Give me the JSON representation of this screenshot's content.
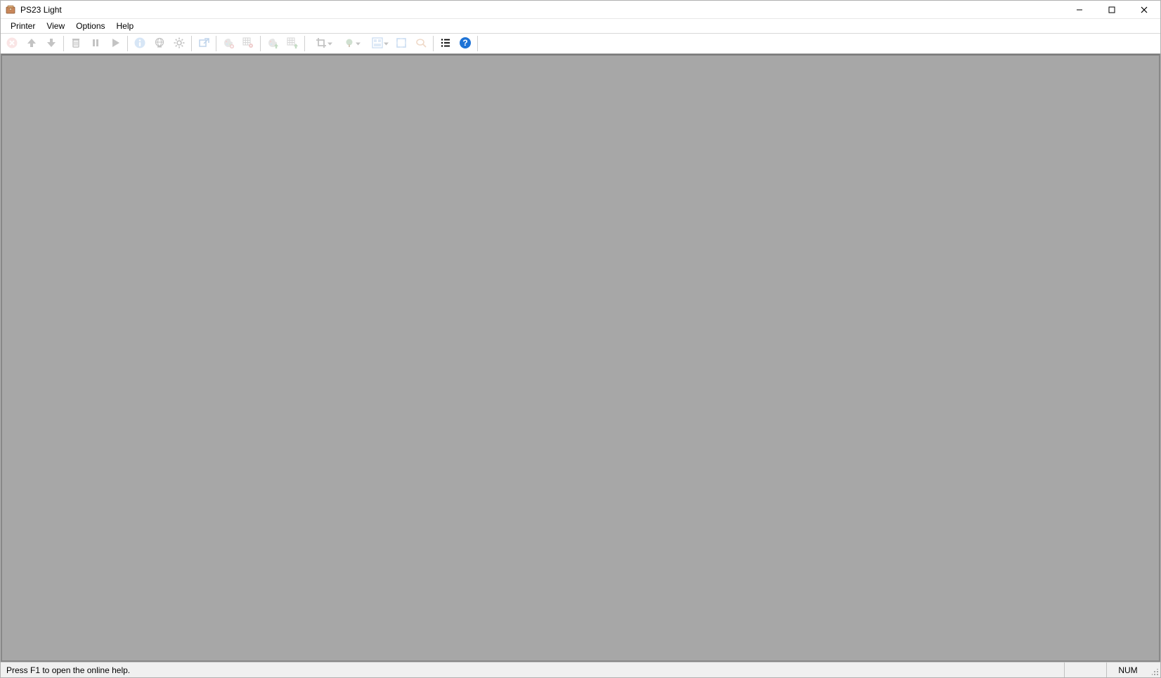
{
  "window": {
    "title": "PS23 Light"
  },
  "menu": {
    "items": [
      "Printer",
      "View",
      "Options",
      "Help"
    ]
  },
  "toolbar": {
    "icons": {
      "cancel": "cancel-icon",
      "up": "arrow-up-icon",
      "down": "arrow-down-icon",
      "delete": "trash-icon",
      "pause": "pause-icon",
      "play": "play-icon",
      "info": "info-icon",
      "globe": "globe-icon",
      "gear": "gear-icon",
      "external": "external-link-icon",
      "palette_add": "palette-add-icon",
      "grid_gear": "grid-gear-icon",
      "palette_up": "palette-up-icon",
      "grid_up": "grid-up-icon",
      "crop": "crop-icon",
      "tree": "tree-icon",
      "layout": "layout-icon",
      "fit": "fit-screen-icon",
      "loupe": "loupe-icon",
      "list": "list-icon",
      "help": "help-icon"
    }
  },
  "statusbar": {
    "hint": "Press F1 to open the online help.",
    "num": "NUM"
  },
  "colors": {
    "help_button": "#1e73d6",
    "cancel_button": "#d94b4b",
    "workarea_bg": "#a7a7a7"
  }
}
